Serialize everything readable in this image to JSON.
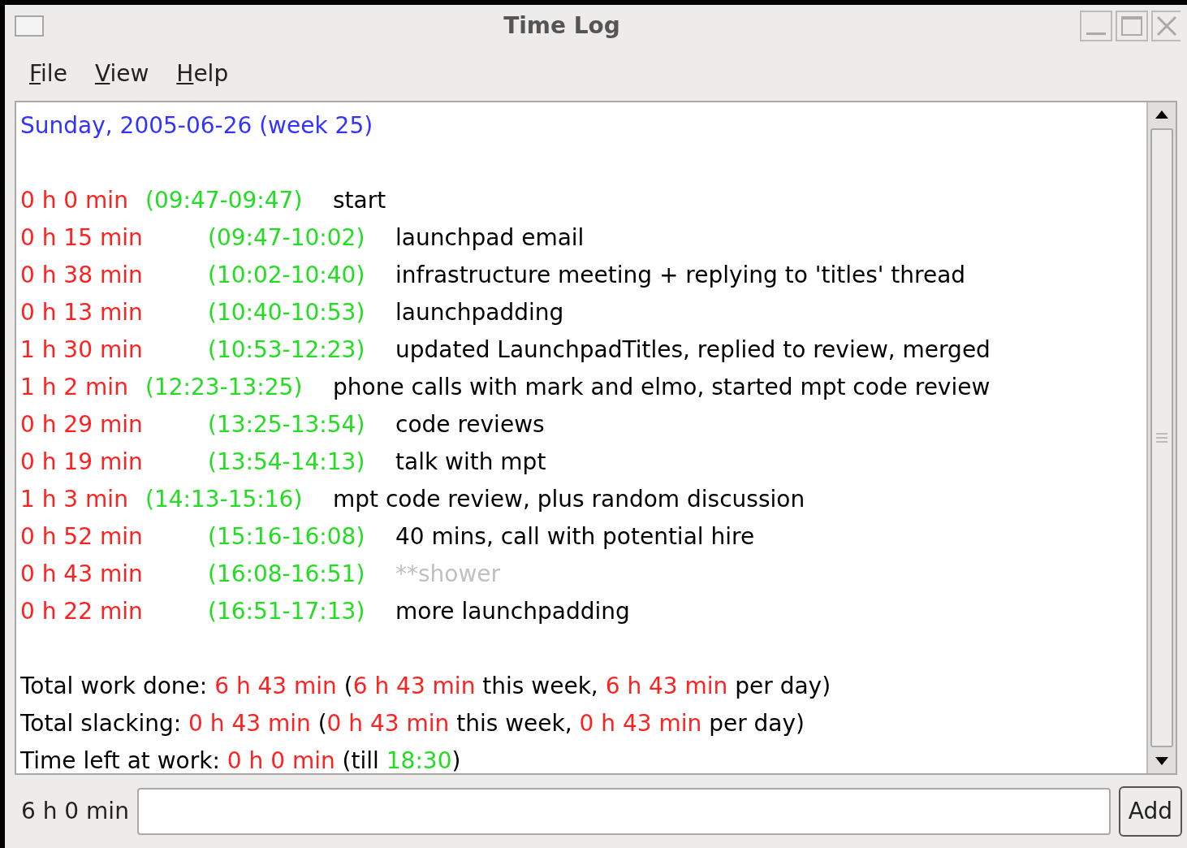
{
  "window": {
    "title": "Time Log"
  },
  "menu": [
    {
      "label": "File"
    },
    {
      "label": "View"
    },
    {
      "label": "Help"
    }
  ],
  "log": {
    "date_heading": "Sunday, 2005-06-26 (week 25)",
    "entries": [
      {
        "duration": "0 h 0 min",
        "range": "(09:47-09:47)",
        "description": "start",
        "slacking": false
      },
      {
        "duration": "0 h 15 min",
        "range": "(09:47-10:02)",
        "description": "launchpad email",
        "slacking": false
      },
      {
        "duration": "0 h 38 min",
        "range": "(10:02-10:40)",
        "description": "infrastructure meeting + replying to 'titles' thread",
        "slacking": false
      },
      {
        "duration": "0 h 13 min",
        "range": "(10:40-10:53)",
        "description": "launchpadding",
        "slacking": false
      },
      {
        "duration": "1 h 30 min",
        "range": "(10:53-12:23)",
        "description": "updated LaunchpadTitles, replied to review, merged",
        "slacking": false
      },
      {
        "duration": "1 h 2 min",
        "range": "(12:23-13:25)",
        "description": "phone calls with mark and elmo, started mpt code review",
        "slacking": false
      },
      {
        "duration": "0 h 29 min",
        "range": "(13:25-13:54)",
        "description": "code reviews",
        "slacking": false
      },
      {
        "duration": "0 h 19 min",
        "range": "(13:54-14:13)",
        "description": "talk with mpt",
        "slacking": false
      },
      {
        "duration": "1 h 3 min",
        "range": "(14:13-15:16)",
        "description": "mpt code review, plus random discussion",
        "slacking": false
      },
      {
        "duration": "0 h 52 min",
        "range": "(15:16-16:08)",
        "description": "40 mins, call with potential hire",
        "slacking": false
      },
      {
        "duration": "0 h 43 min",
        "range": "(16:08-16:51)",
        "description": "**shower",
        "slacking": true
      },
      {
        "duration": "0 h 22 min",
        "range": "(16:51-17:13)",
        "description": "more launchpadding",
        "slacking": false
      }
    ],
    "summary": [
      [
        {
          "kind": "plain",
          "text": "Total work done: "
        },
        {
          "kind": "duration",
          "text": "6 h 43 min"
        },
        {
          "kind": "plain",
          "text": " ("
        },
        {
          "kind": "duration",
          "text": "6 h 43 min"
        },
        {
          "kind": "plain",
          "text": " this week, "
        },
        {
          "kind": "duration",
          "text": "6 h 43 min"
        },
        {
          "kind": "plain",
          "text": " per day)"
        }
      ],
      [
        {
          "kind": "plain",
          "text": "Total slacking: "
        },
        {
          "kind": "duration",
          "text": "0 h 43 min"
        },
        {
          "kind": "plain",
          "text": " ("
        },
        {
          "kind": "duration",
          "text": "0 h 43 min"
        },
        {
          "kind": "plain",
          "text": " this week, "
        },
        {
          "kind": "duration",
          "text": "0 h 43 min"
        },
        {
          "kind": "plain",
          "text": " per day)"
        }
      ],
      [
        {
          "kind": "plain",
          "text": "Time left at work: "
        },
        {
          "kind": "duration",
          "text": "0 h 0 min"
        },
        {
          "kind": "plain",
          "text": " (till "
        },
        {
          "kind": "time",
          "text": "18:30"
        },
        {
          "kind": "plain",
          "text": ")"
        }
      ]
    ]
  },
  "input_bar": {
    "elapsed": "6 h 0 min",
    "button": "Add"
  }
}
